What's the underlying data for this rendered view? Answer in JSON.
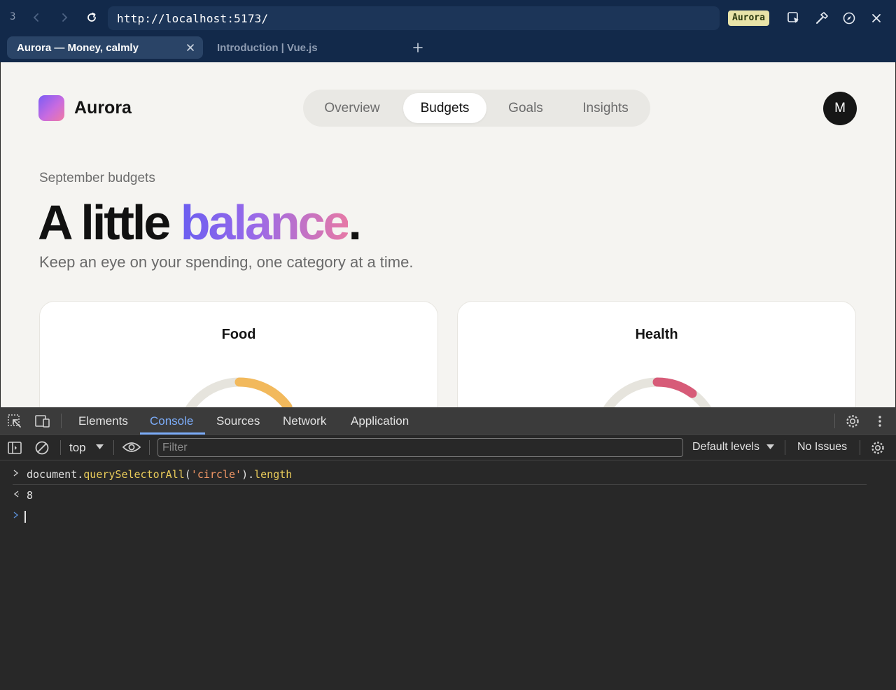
{
  "browser": {
    "tab_count": "3",
    "url": "http://localhost:5173/",
    "badge": "Aurora",
    "tabs": [
      {
        "title": "Aurora — Money, calmly",
        "active": true
      },
      {
        "title": "Introduction | Vue.js",
        "active": false
      }
    ],
    "icons": [
      "back-icon",
      "forward-icon",
      "reload-icon",
      "select-element-icon",
      "hammer-icon",
      "compass-icon",
      "close-icon",
      "new-tab-icon"
    ]
  },
  "app": {
    "brand": "Aurora",
    "nav": [
      "Overview",
      "Budgets",
      "Goals",
      "Insights"
    ],
    "active_nav": "Budgets",
    "avatar_initial": "M",
    "eyebrow": "September budgets",
    "headline": {
      "part1": "A little ",
      "highlight": "balance",
      "end": "."
    },
    "subtitle": "Keep an eye on your spending, one category at a time.",
    "cards": [
      {
        "title": "Food",
        "accent": "#f2b95c",
        "fill": 0.3
      },
      {
        "title": "Health",
        "accent": "#d75b78",
        "fill": 0.2
      }
    ],
    "colors": {
      "page_bg": "#f5f4f1",
      "track": "#e6e4dd",
      "gradient_start": "#6b5ef0",
      "gradient_end": "#e679a6"
    }
  },
  "devtools": {
    "tabs": [
      "Elements",
      "Console",
      "Sources",
      "Network",
      "Application"
    ],
    "active_tab": "Console",
    "context": "top",
    "filter_placeholder": "Filter",
    "levels": "Default levels",
    "issues": "No Issues",
    "console": {
      "input": {
        "obj": "document.",
        "method": "querySelectorAll",
        "open": "(",
        "arg": "'circle'",
        "close": ").",
        "prop": "length"
      },
      "output": "8"
    }
  }
}
